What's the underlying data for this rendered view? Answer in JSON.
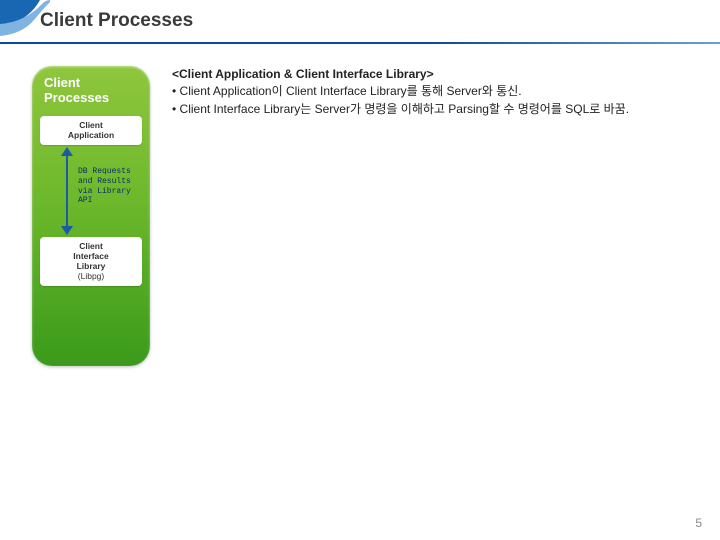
{
  "header": {
    "title": "Client Processes"
  },
  "panel": {
    "title_line1": "Client",
    "title_line2": "Processes",
    "box_top_line1": "Client",
    "box_top_line2": "Application",
    "connector_label": "DB Requests and Results via Library API",
    "box_bottom_line1": "Client",
    "box_bottom_line2": "Interface",
    "box_bottom_line3": "Library",
    "box_bottom_line4": "(Libpg)"
  },
  "desc": {
    "heading": "<Client Application & Client Interface Library>",
    "bullet1": "• Client Application이 Client Interface Library를 통해 Server와 통신.",
    "bullet2": "• Client Interface Library는 Server가 명령을 이해하고 Parsing할 수 명령어를 SQL로 바꿈."
  },
  "page": "5"
}
